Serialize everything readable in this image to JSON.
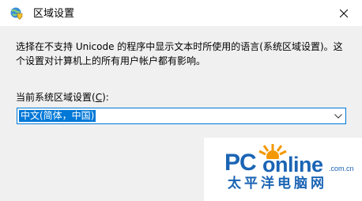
{
  "window": {
    "title": "区域设置",
    "app_icon": "globe-shield-icon",
    "close_icon": "close-icon"
  },
  "body": {
    "description_line1": "选择在不支持 Unicode 的程序中显示文本时所使用的语言(系统区域设置)。这",
    "description_line2": "个设置对计算机上的所有用户帐户都有影响。",
    "locale_label_prefix": "当前系统区域设置(",
    "locale_label_accel": "C",
    "locale_label_suffix": "):",
    "locale_value": "中文(简体，中国)",
    "dropdown_icon": "chevron-down-icon"
  },
  "watermark": {
    "brand_pc": "PC",
    "brand_online": "online",
    "domain": ".com.cn",
    "chinese": "太平洋电脑网",
    "brand_color": "#1a64b4",
    "accent_color": "#f39800"
  },
  "colors": {
    "selection": "#0078d7",
    "dialog_bg": "#f0f0f0"
  }
}
